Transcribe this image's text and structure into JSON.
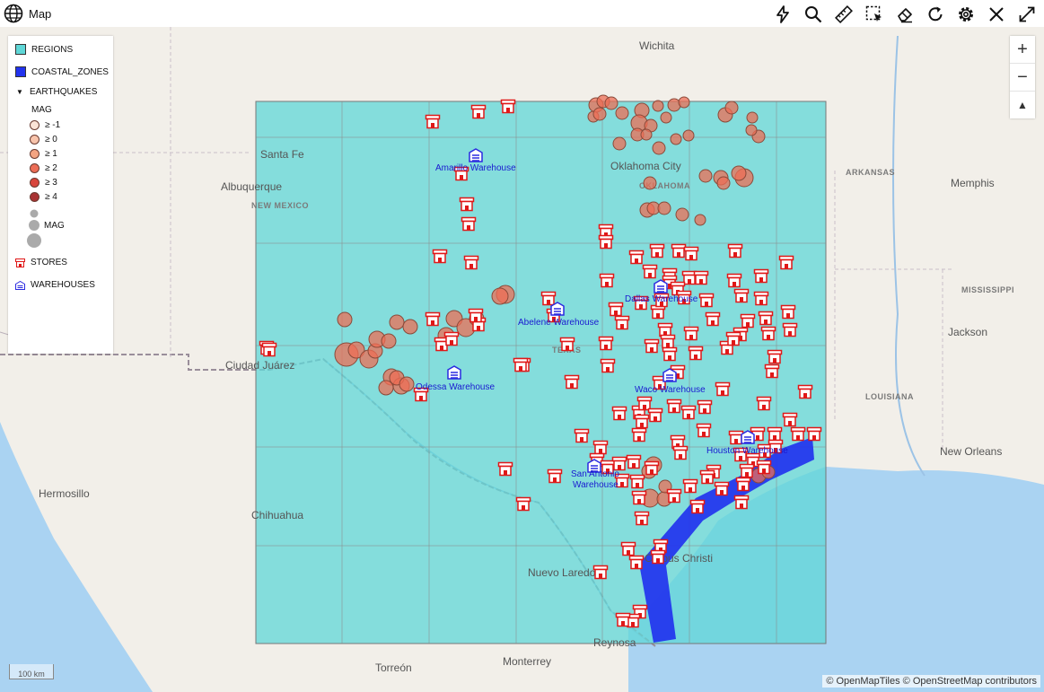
{
  "app": {
    "title": "Map"
  },
  "toolbar": {
    "tools": [
      "lightning-icon",
      "search-icon",
      "ruler-icon",
      "select-area-icon",
      "eraser-icon",
      "refresh-icon",
      "gear-icon",
      "close-icon",
      "expand-icon"
    ]
  },
  "legend": {
    "regions": "REGIONS",
    "coastal": "COASTAL_ZONES",
    "earthquakes": "EARTHQUAKES",
    "mag_header": "MAG",
    "mag_classes": [
      "≥ -1",
      "≥ 0",
      "≥ 1",
      "≥ 2",
      "≥ 3",
      "≥ 4"
    ],
    "mag_colors": [
      "#fbe3d6",
      "#f8c4ac",
      "#f4a482",
      "#ec6d56",
      "#d8453c",
      "#a83232"
    ],
    "size_label": "MAG",
    "stores": "STORES",
    "warehouses": "WAREHOUSES"
  },
  "colors": {
    "region_fill": "#5fd7d7",
    "coastal_fill": "#2233ee",
    "store": "#e01818",
    "warehouse": "#2a2ae0",
    "quake": "#ec6d56"
  },
  "map_labels": {
    "wichita": "Wichita",
    "santa_fe": "Santa Fe",
    "albuquerque": "Albuquerque",
    "new_mexico": "NEW MEXICO",
    "oklahoma_city": "Oklahoma City",
    "oklahoma": "OKLAHOMA",
    "arkansas": "ARKANSAS",
    "memphis": "Memphis",
    "mississippi": "MISSISSIPPI",
    "jackson": "Jackson",
    "louisiana": "LOUISIANA",
    "new_orleans": "New Orleans",
    "ciudad_juarez": "Ciudad Juárez",
    "hermosillo": "Hermosillo",
    "chihuahua": "Chihuahua",
    "nuevo_laredo": "Nuevo Laredo",
    "reynosa": "Reynosa",
    "torreon": "Torreón",
    "monterrey": "Monterrey",
    "texas": "TEXAS",
    "corpus": "Corpus Christi"
  },
  "warehouse_labels": {
    "amarillo": "Amarillo Warehouse",
    "dallas": "Dallas Warehouse",
    "abelene": "Abelene Warehouse",
    "odessa": "Odessa Warehouse",
    "waco": "Waco Warehouse",
    "houston": "Houston Warehouse",
    "san_antonio_1": "San Antonio",
    "san_antonio_2": "Warehouse"
  },
  "zoom": {
    "in": "+",
    "out": "−",
    "reset": "▲"
  },
  "scale": "100 km",
  "attribution": "© OpenMapTiles  © OpenStreetMap contributors"
}
